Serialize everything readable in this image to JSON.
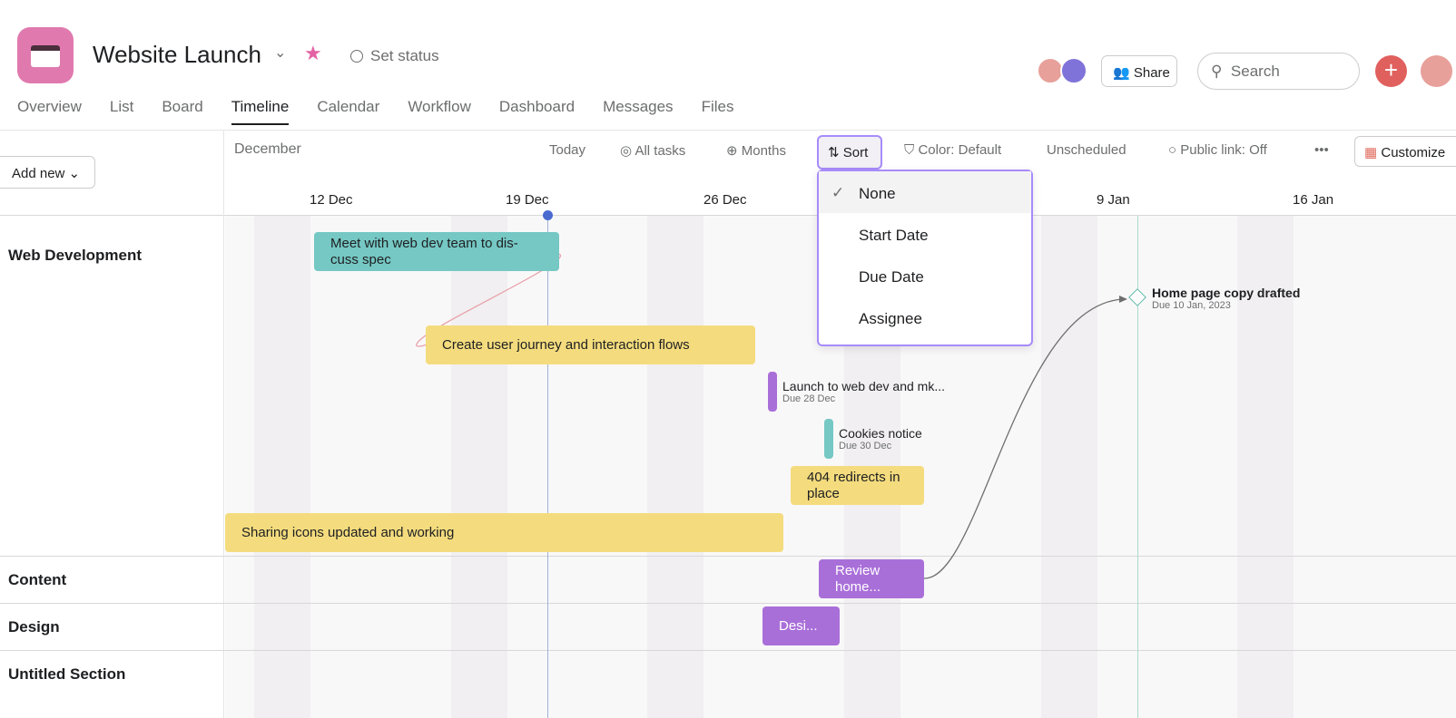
{
  "project": {
    "title": "Website Launch",
    "status": "Set status",
    "brand_color": "#e07aae",
    "star_color": "#e362a4"
  },
  "tabs": [
    "Overview",
    "List",
    "Board",
    "Timeline",
    "Calendar",
    "Workflow",
    "Dashboard",
    "Messages",
    "Files"
  ],
  "active_tab": "Timeline",
  "header": {
    "share": "Share",
    "search_placeholder": "Search",
    "add_icon": "plus-icon"
  },
  "toolbar": {
    "add_new": "Add new",
    "month": "December",
    "today": "Today",
    "all_tasks": "All tasks",
    "months": "Months",
    "sort": "Sort",
    "color": "Color: Default",
    "unscheduled": "Unscheduled",
    "public_link": "Public link: Off",
    "more": "•••",
    "customize": "Customize"
  },
  "dates": [
    "12 Dec",
    "19 Dec",
    "26 Dec",
    "9 Jan",
    "16 Jan"
  ],
  "sort_menu": {
    "options": [
      "None",
      "Start Date",
      "Due Date",
      "Assignee"
    ],
    "selected": "None"
  },
  "sections": [
    "Web Development",
    "Content",
    "Design",
    "Untitled Section"
  ],
  "tasks": [
    {
      "name": "Meet with web dev team to dis-cuss spec",
      "color": "#75c8c4"
    },
    {
      "name": "Create user journey and interaction flows",
      "color": "#f4dc7e"
    },
    {
      "name": "Launch to web dev and mk...",
      "due": "Due 28 Dec",
      "color": "#a96fd9"
    },
    {
      "name": "Cookies notice",
      "due": "Due 30 Dec",
      "color": "#75c8c4"
    },
    {
      "name": "404 redirects in place",
      "color": "#f4dc7e"
    },
    {
      "name": "Sharing icons updated and working",
      "color": "#f4dc7e"
    },
    {
      "name": "Review home...",
      "color": "#a96fd9"
    },
    {
      "name": "Desi...",
      "color": "#a96fd9"
    }
  ],
  "milestone": {
    "name": "Home page copy drafted",
    "due": "Due 10 Jan, 2023"
  }
}
